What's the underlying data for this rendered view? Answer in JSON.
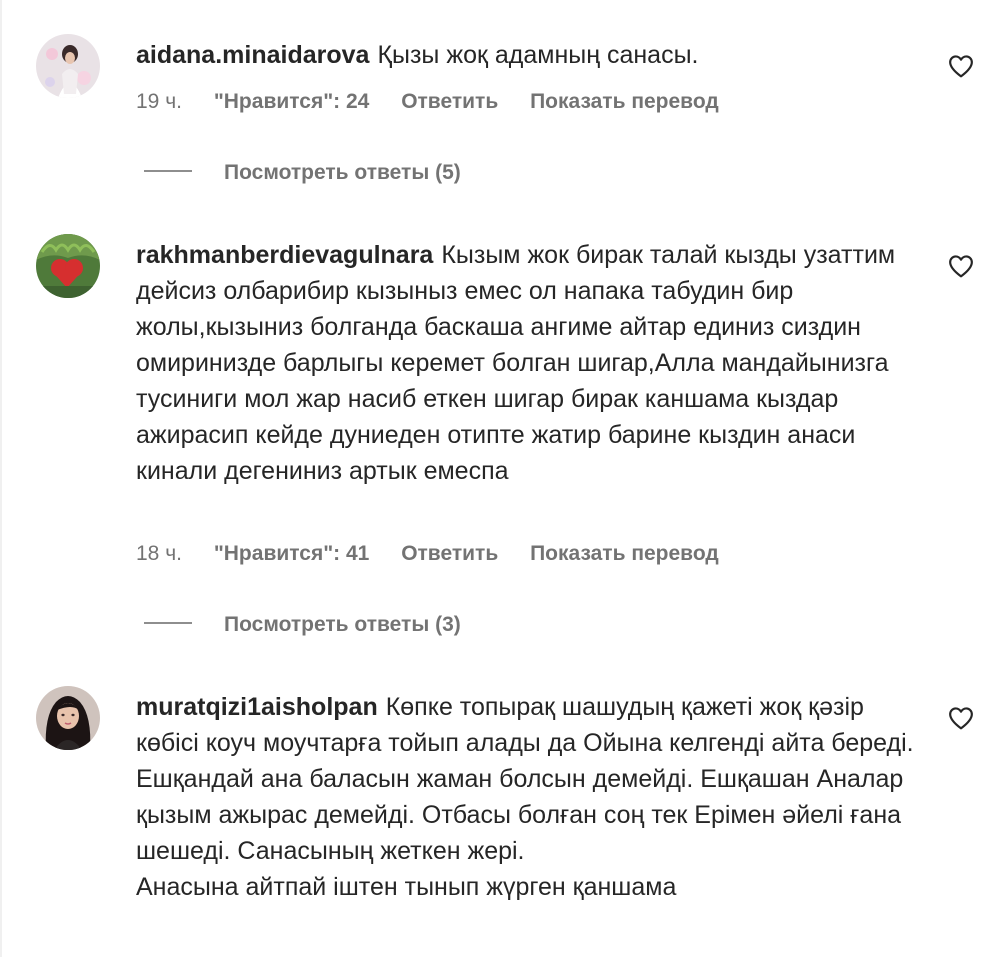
{
  "comments": [
    {
      "username": "aidana.minaidarova",
      "text": "Қызы жоқ адамның санасы.",
      "time": "19 ч.",
      "likes": "\"Нравится\": 24",
      "reply_label": "Ответить",
      "translate_label": "Показать перевод",
      "view_replies": "Посмотреть ответы (5)"
    },
    {
      "username": "rakhmanberdievagulnara",
      "text": "Кызым жок бирак талай кызды узаттим дейсиз олбарибир кызыныз емес ол напака табудин бир жолы,кызыниз болганда баскаша ангиме айтар единиз сиздин омиринизде барлыгы керемет болган шигар,Алла мандайынизга тусиниги мол жар насиб еткен шигар бирак каншама кыздар ажирасип кейде дуниеден отипте жатир барине кыздин анаси кинали дегениниз артык емеспа",
      "time": "18 ч.",
      "likes": "\"Нравится\": 41",
      "reply_label": "Ответить",
      "translate_label": "Показать перевод",
      "view_replies": "Посмотреть ответы (3)"
    },
    {
      "username": "muratqizi1aisholpan",
      "text": "Көпке топырақ шашудың қажеті жоқ қәзір көбісі коуч моучтарға тойып алады да Ойына келгенді айта береді. Ешқандай ана баласын жаман болсын демейді. Ешқашан Аналар қызым ажырас демейді. Отбасы болған соң тек Ерімен әйелі ғана шешеді. Санасының жеткен жері.",
      "text2": "Анасына айтпай іштен тынып жүрген қаншама"
    }
  ]
}
